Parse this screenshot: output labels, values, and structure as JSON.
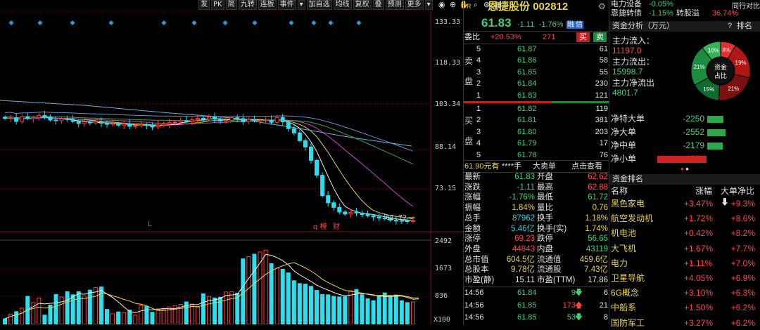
{
  "toolbar": {
    "buttons": [
      "发",
      "PK",
      "简",
      "九转",
      "连板",
      "事件",
      "▾",
      "加自选",
      "均线",
      "复权",
      "叠",
      "预测",
      "更多",
      "▾"
    ],
    "icons": [
      "eye-icon",
      "zoom-in-icon",
      "hand-icon",
      "search-icon",
      "close-icon",
      "grid-icon"
    ]
  },
  "price_axis": [
    "133.33",
    "118.33",
    "103.34",
    "88.14",
    "73.15",
    "61.72"
  ],
  "volume_axis": [
    "2492",
    "1673",
    "836",
    "X100"
  ],
  "chart_markers": {
    "left_marker": "L",
    "q_marker": "q 榜",
    "cai_marker": "财"
  },
  "chart_data": {
    "type": "candlestick",
    "price_range": [
      58,
      135
    ],
    "last_price_label": "61.72",
    "closes": [
      97.6,
      97.8,
      96.5,
      98.2,
      97.5,
      97.9,
      98.6,
      98.1,
      97.0,
      96.8,
      97.4,
      97.2,
      96.5,
      95.8,
      96.3,
      96.0,
      96.4,
      95.9,
      95.5,
      95.8,
      95.2,
      95.7,
      94.8,
      95.0,
      95.4,
      95.1,
      94.6,
      95.2,
      95.6,
      96.1,
      96.3,
      96.8,
      96.6,
      97.1,
      97.6,
      97.4,
      98.0,
      97.3,
      96.7,
      96.9,
      97.8,
      97.5,
      96.4,
      97.2,
      96.8,
      96.9,
      97.0,
      96.2,
      97.9,
      96.4,
      94.0,
      92.5,
      89.8,
      87.6,
      82.9,
      77.7,
      70.6,
      68.1,
      66.5,
      64.9,
      64.2,
      64.8,
      64.5,
      64.0,
      63.6,
      63.2,
      62.8,
      62.7,
      62.0,
      61.9,
      61.8,
      61.6,
      61.83
    ],
    "volume_range": [
      0,
      2700
    ],
    "volumes": [
      180,
      330,
      410,
      520,
      900,
      700,
      850,
      300,
      620,
      960,
      880,
      1050,
      950,
      1050,
      910,
      1100,
      1180,
      1200,
      480,
      340,
      400,
      380,
      460,
      300,
      620,
      580,
      390,
      500,
      480,
      560,
      600,
      640,
      720,
      650,
      550,
      980,
      900,
      850,
      870,
      1040,
      1050,
      1000,
      2100,
      2170,
      2250,
      2320,
      2380,
      1950,
      1800,
      1770,
      1650,
      1400,
      1310,
      1290,
      1220,
      1090,
      960,
      950,
      900,
      880,
      890,
      1080,
      1120,
      950,
      820,
      760,
      920,
      1010,
      900,
      940,
      760,
      700,
      720,
      980
    ]
  },
  "stock": {
    "industry": "电力设备",
    "industry_change": "-0.05%",
    "related": "恩捷转债",
    "related_change": "-1.15%",
    "conv_label": "转股溢",
    "conv_value": "36.74%",
    "peer_label": "同行对比",
    "name": "恩捷股份",
    "code": "002812",
    "r_tag": "R",
    "price": "61.83",
    "change": "-1.11",
    "change_pct": "-1.76%",
    "margin_tag": "融",
    "credit_tag": "信"
  },
  "order_book": {
    "weibi_label": "委比",
    "weibi_value": "+20.53%",
    "weibi_diff": "271",
    "buy_btn": "买",
    "sell_btn": "卖",
    "sell_side_label": [
      "卖",
      "盘"
    ],
    "buy_side_label": [
      "买",
      "盘"
    ],
    "asks": [
      {
        "lvl": "5",
        "price": "61.87",
        "vol": "61"
      },
      {
        "lvl": "4",
        "price": "61.86",
        "vol": "58"
      },
      {
        "lvl": "3",
        "price": "61.85",
        "vol": "55"
      },
      {
        "lvl": "2",
        "price": "61.84",
        "vol": "230"
      },
      {
        "lvl": "1",
        "price": "61.83",
        "vol": "121"
      }
    ],
    "bids": [
      {
        "lvl": "1",
        "price": "61.82",
        "vol": "119"
      },
      {
        "lvl": "2",
        "price": "61.81",
        "vol": "381"
      },
      {
        "lvl": "3",
        "price": "61.80",
        "vol": "203"
      },
      {
        "lvl": "4",
        "price": "61.79",
        "vol": "17"
      },
      {
        "lvl": "5",
        "price": "61.78",
        "vol": "76"
      }
    ],
    "big_order_text": "61.90元有",
    "big_order_hidden": "****手",
    "big_order_type": "大卖单",
    "big_order_link": "点击查看"
  },
  "stats": [
    {
      "l1": "最新",
      "v1": "61.83",
      "l2": "开盘",
      "v2": "62.62",
      "c1": "g",
      "c2": "r"
    },
    {
      "l1": "涨跌",
      "v1": "-1.11",
      "l2": "最高",
      "v2": "62.88",
      "c1": "g",
      "c2": "r"
    },
    {
      "l1": "涨幅",
      "v1": "-1.76%",
      "l2": "最低",
      "v2": "61.72",
      "c1": "g",
      "c2": "g"
    },
    {
      "l1": "振幅",
      "v1": "1.84%",
      "l2": "量比",
      "v2": "0.76",
      "c1": "y",
      "c2": "y"
    },
    {
      "l1": "总手",
      "v1": "87962",
      "l2": "换手",
      "v2": "1.18%",
      "c1": "c",
      "c2": "y"
    },
    {
      "l1": "金额",
      "v1": "5.46亿",
      "l2": "换手(实)",
      "v2": "1.74%",
      "c1": "c",
      "c2": "y"
    },
    {
      "l1": "涨停",
      "v1": "69.23",
      "l2": "跌停",
      "v2": "56.65",
      "c1": "r",
      "c2": "g"
    },
    {
      "l1": "外盘",
      "v1": "44843",
      "l2": "内盘",
      "v2": "43119",
      "c1": "r",
      "c2": "g"
    },
    {
      "l1": "总市值",
      "v1": "604.5亿",
      "l2": "流通值",
      "v2": "459.6亿",
      "c1": "y",
      "c2": "y"
    },
    {
      "l1": "总股本",
      "v1": "9.78亿",
      "l2": "流通股",
      "v2": "7.43亿",
      "c1": "y",
      "c2": "y"
    },
    {
      "l1": "市盈(静)",
      "v1": "15.11",
      "l2": "市盈(TTM)",
      "v2": "17.86",
      "c1": "w",
      "c2": "w"
    }
  ],
  "ticks": [
    {
      "time": "14:56",
      "price": "61.84",
      "vol": "9",
      "dir": "down",
      "n": "6"
    },
    {
      "time": "14:56",
      "price": "61.85",
      "vol": "173",
      "dir": "up",
      "n": "21"
    },
    {
      "time": "14:56",
      "price": "61.85",
      "vol": "53",
      "dir": "down",
      "n": "8"
    }
  ],
  "fund_analysis": {
    "title": "资金分析（万元）",
    "rank_label": "排名",
    "main_in_label": "主力流入：",
    "main_in": "11197.0",
    "main_out_label": "主力流出：",
    "main_out": "15998.7",
    "main_net_label": "主力净流出",
    "main_net": "4801.7",
    "donut_center": [
      "资金",
      "占比"
    ],
    "donut": [
      {
        "pct": "8%",
        "value": 8,
        "color": "#e03030"
      },
      {
        "pct": "19%",
        "value": 19,
        "color": "#b01818"
      },
      {
        "pct": "21%",
        "value": 21,
        "color": "#7a1010"
      },
      {
        "pct": "15%",
        "value": 15,
        "color": "#0f6b2e"
      },
      {
        "pct": "21%",
        "value": 21,
        "color": "#1c8c40"
      },
      {
        "pct": "10%",
        "value": 10,
        "color": "#34b35a"
      }
    ],
    "flows": [
      {
        "label": "净特大单",
        "value": "-2250",
        "ratio": 0.33,
        "color": "#2aa84a"
      },
      {
        "label": "净大单",
        "value": "-2552",
        "ratio": 0.37,
        "color": "#2aa84a"
      },
      {
        "label": "净中单",
        "value": "-2179",
        "ratio": 0.32,
        "color": "#2aa84a"
      },
      {
        "label": "净小单",
        "value": "6981",
        "ratio": 1.0,
        "color": "#cc2222"
      }
    ]
  },
  "sector_rank": {
    "title": "资金排名",
    "headers": [
      "名称",
      "涨幅",
      "大单净比"
    ],
    "rows": [
      {
        "name": "黑色家电",
        "chg": "+3.47%",
        "net": "+9.3%"
      },
      {
        "name": "航空发动机",
        "chg": "+1.72%",
        "net": "+8.6%"
      },
      {
        "name": "机电池",
        "chg": "+0.42%",
        "net": "+8.2%"
      },
      {
        "name": "大飞机",
        "chg": "+1.67%",
        "net": "+7.7%"
      },
      {
        "name": "电力",
        "chg": "+1.11%",
        "net": "+7.0%"
      },
      {
        "name": "卫星导航",
        "chg": "+4.05%",
        "net": "+6.9%"
      },
      {
        "name": "6G概念",
        "chg": "+3.10%",
        "net": "+6.3%"
      },
      {
        "name": "中船系",
        "chg": "+1.50%",
        "net": "+6.2%"
      },
      {
        "name": "国防军工",
        "chg": "+3.27%",
        "net": "+6.2%"
      }
    ]
  }
}
